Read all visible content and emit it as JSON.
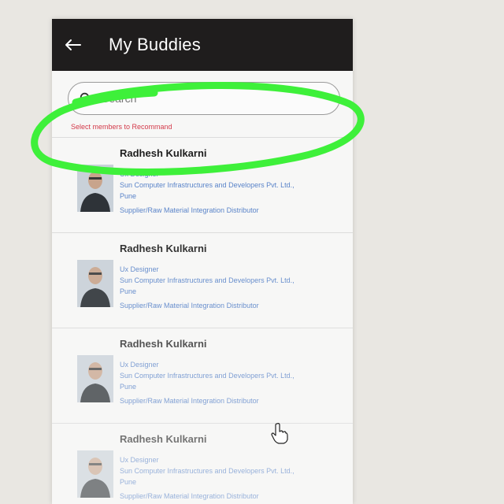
{
  "header": {
    "title": "My Buddies"
  },
  "search": {
    "placeholder": "Search"
  },
  "hint_text": "Select members to Recommand",
  "buddies": [
    {
      "name": "Radhesh Kulkarni",
      "role": "Ux Designer",
      "company": "Sun Computer Infrastructures and Developers Pvt. Ltd.,",
      "city": "Pune",
      "category": "Supplier/Raw Material Integration Distributor"
    },
    {
      "name": "Radhesh Kulkarni",
      "role": "Ux Designer",
      "company": "Sun Computer Infrastructures and Developers Pvt. Ltd.,",
      "city": "Pune",
      "category": "Supplier/Raw Material Integration Distributor"
    },
    {
      "name": "Radhesh Kulkarni",
      "role": "Ux Designer",
      "company": "Sun Computer Infrastructures and Developers Pvt. Ltd.,",
      "city": "Pune",
      "category": "Supplier/Raw Material Integration Distributor"
    },
    {
      "name": "Radhesh Kulkarni",
      "role": "Ux Designer",
      "company": "Sun Computer Infrastructures and Developers Pvt. Ltd.,",
      "city": "Pune",
      "category": "Supplier/Raw Material Integration Distributor"
    }
  ],
  "colors": {
    "header_bg": "#1f1d1d",
    "hint": "#d33a4a",
    "detail_text": "#5a84c9",
    "annotation": "#3ef03a"
  },
  "icons": {
    "back": "arrow-left-icon",
    "search": "search-icon",
    "cursor": "hand-pointer-icon"
  }
}
